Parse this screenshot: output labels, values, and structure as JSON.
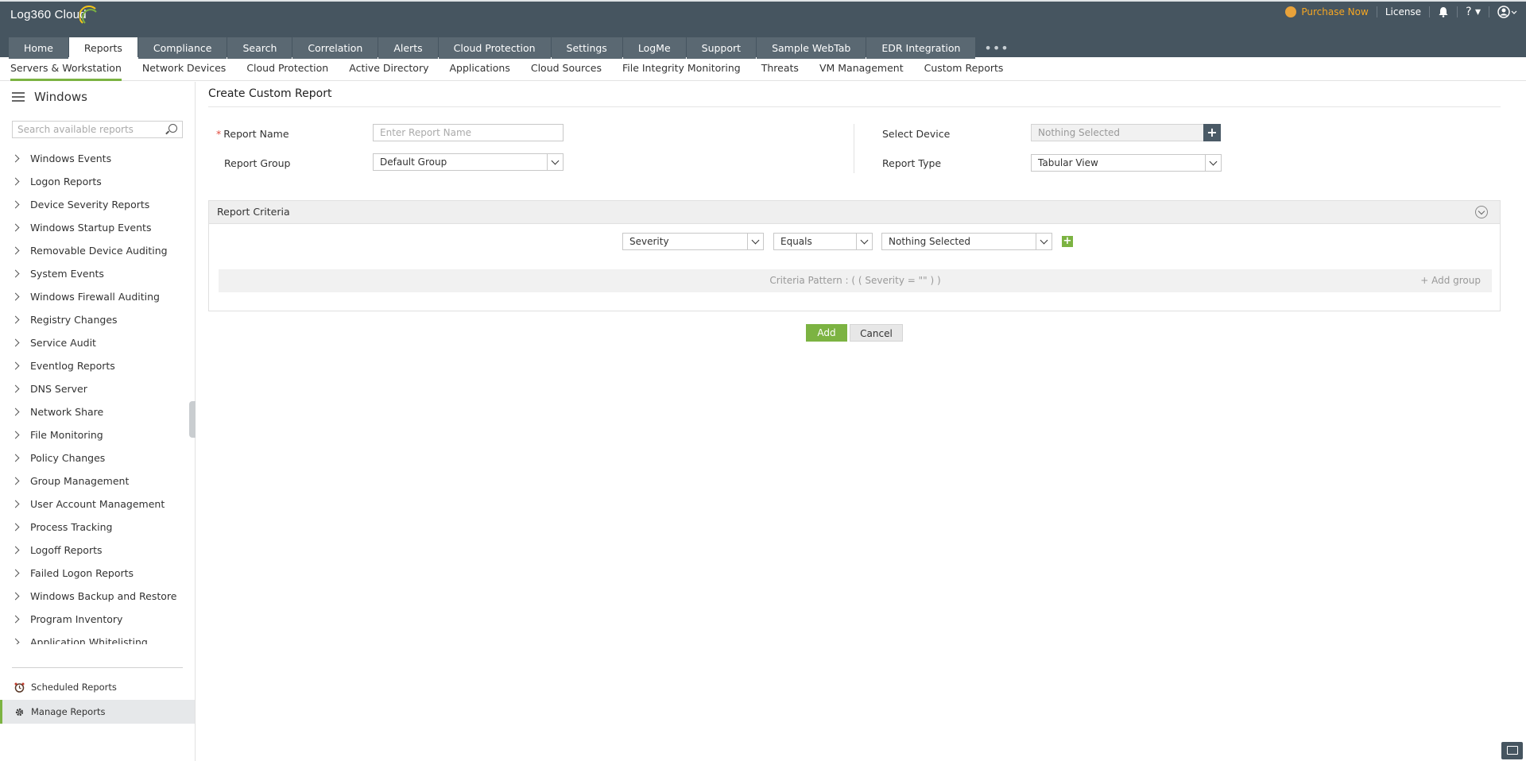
{
  "app": {
    "logo_text": "Log360 Cloud",
    "purchase_label": "Purchase Now",
    "license_label": "License",
    "help_label": "?"
  },
  "main_tabs": [
    "Home",
    "Reports",
    "Compliance",
    "Search",
    "Correlation",
    "Alerts",
    "Cloud Protection",
    "Settings",
    "LogMe",
    "Support",
    "Sample WebTab",
    "EDR Integration"
  ],
  "active_main_tab": "Reports",
  "sub_tabs": [
    "Servers & Workstation",
    "Network Devices",
    "Cloud Protection",
    "Active Directory",
    "Applications",
    "Cloud Sources",
    "File Integrity Monitoring",
    "Threats",
    "VM Management",
    "Custom Reports"
  ],
  "sidebar": {
    "title": "Windows",
    "search_placeholder": "Search available reports",
    "items": [
      "Windows Events",
      "Logon Reports",
      "Device Severity Reports",
      "Windows Startup Events",
      "Removable Device Auditing",
      "System Events",
      "Windows Firewall Auditing",
      "Registry Changes",
      "Service Audit",
      "Eventlog Reports",
      "DNS Server",
      "Network Share",
      "File Monitoring",
      "Policy Changes",
      "Group Management",
      "User Account Management",
      "Process Tracking",
      "Logoff Reports",
      "Failed Logon Reports",
      "Windows Backup and Restore",
      "Program Inventory",
      "Application Whitelisting"
    ],
    "scheduled_label": "Scheduled Reports",
    "manage_label": "Manage Reports"
  },
  "form": {
    "title": "Create Custom Report",
    "required_mark": "*",
    "report_name_label": "Report Name",
    "report_name_placeholder": "Enter Report Name",
    "report_group_label": "Report Group",
    "report_group_value": "Default Group",
    "select_device_label": "Select Device",
    "select_device_value": "Nothing Selected",
    "report_type_label": "Report Type",
    "report_type_value": "Tabular View"
  },
  "criteria": {
    "header": "Report Criteria",
    "field_value": "Severity",
    "operator_value": "Equals",
    "value_value": "Nothing Selected",
    "pattern_text": "Criteria Pattern : ( ( Severity = \"\" ) )",
    "add_group_label": "+ Add group"
  },
  "actions": {
    "add_label": "Add",
    "cancel_label": "Cancel"
  }
}
